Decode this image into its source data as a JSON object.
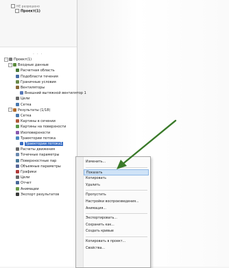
{
  "panel_top": {
    "tab_label": "НЕ разрешено",
    "project_label": "Проект(1)"
  },
  "divider": "· · ·",
  "tree": [
    {
      "label": "Проект(1)",
      "indent": 0,
      "icon": "project-icon",
      "color": "#7a7a7a"
    },
    {
      "label": "Входные данные",
      "indent": 1,
      "icon": "input-data-icon",
      "color": "#5a8a3a"
    },
    {
      "label": "Расчетная область",
      "indent": 2,
      "icon": "domain-icon",
      "color": "#4a7a3a"
    },
    {
      "label": "Подобласти течения",
      "indent": 2,
      "icon": "fluid-subdomain-icon",
      "color": "#4a6fa8"
    },
    {
      "label": "Граничные условия",
      "indent": 2,
      "icon": "boundary-icon",
      "color": "#6a8a4a"
    },
    {
      "label": "Вентиляторы",
      "indent": 2,
      "icon": "fan-icon",
      "color": "#8a6a3a"
    },
    {
      "label": "Внешний вытяжной вентилятор 1",
      "indent": 3,
      "icon": "fan-item-icon",
      "color": "#5a7ab8"
    },
    {
      "label": "Цели",
      "indent": 2,
      "icon": "goals-icon",
      "color": "#6a6a6a"
    },
    {
      "label": "Сетка",
      "indent": 2,
      "icon": "mesh-icon",
      "color": "#4a7ab0"
    },
    {
      "label": "Результаты (1/18)",
      "indent": 1,
      "icon": "results-icon",
      "color": "#b06a2a"
    },
    {
      "label": "Сетка",
      "indent": 2,
      "icon": "mesh-icon",
      "color": "#4a7ab0"
    },
    {
      "label": "Картины в сечении",
      "indent": 2,
      "icon": "cut-plot-icon",
      "color": "#b05a3a"
    },
    {
      "label": "Картины на поверхности",
      "indent": 2,
      "icon": "surface-plot-icon",
      "color": "#5a9a4a"
    },
    {
      "label": "Изоповерхности",
      "indent": 2,
      "icon": "isosurface-icon",
      "color": "#8a5ab0"
    },
    {
      "label": "Траектории потока",
      "indent": 2,
      "icon": "flow-trajectories-icon",
      "color": "#4a8ac0"
    },
    {
      "label": "Траектории потока1",
      "indent": 3,
      "icon": "trajectory-item-icon",
      "color": "#3a6fc4",
      "selected": true
    },
    {
      "label": "Расчеты движения",
      "indent": 2,
      "icon": "particle-study-icon",
      "color": "#6a6a6a"
    },
    {
      "label": "Точечные параметры",
      "indent": 2,
      "icon": "point-params-icon",
      "color": "#6a8ab0"
    },
    {
      "label": "Поверхностные пар",
      "indent": 2,
      "icon": "surface-params-icon",
      "color": "#4a7a9a"
    },
    {
      "label": "Объемные параметры",
      "indent": 2,
      "icon": "volume-params-icon",
      "color": "#5a6a9a"
    },
    {
      "label": "Графики",
      "indent": 2,
      "icon": "xy-plot-icon",
      "color": "#b03a3a"
    },
    {
      "label": "Цели",
      "indent": 2,
      "icon": "goals-icon",
      "color": "#6a6a6a"
    },
    {
      "label": "Отчет",
      "indent": 2,
      "icon": "report-icon",
      "color": "#4a6a9a"
    },
    {
      "label": "Анимации",
      "indent": 2,
      "icon": "animation-icon",
      "color": "#6a9a4a"
    },
    {
      "label": "Экспорт результатов",
      "indent": 2,
      "icon": "export-icon",
      "color": "#3a3a3a"
    }
  ],
  "context_menu": {
    "items": [
      {
        "label": "Изменить...",
        "type": "item"
      },
      {
        "type": "sep"
      },
      {
        "label": "Показать",
        "type": "item",
        "highlight": true
      },
      {
        "label": "Копировать",
        "type": "item"
      },
      {
        "label": "Удалить",
        "type": "item"
      },
      {
        "type": "sep"
      },
      {
        "label": "Пропустить",
        "type": "item"
      },
      {
        "label": "Настройки воспроизведения...",
        "type": "item"
      },
      {
        "label": "Анимация...",
        "type": "item"
      },
      {
        "type": "sep"
      },
      {
        "label": "Экспортировать...",
        "type": "item"
      },
      {
        "label": "Сохранить как...",
        "type": "item"
      },
      {
        "label": "Создать кривые",
        "type": "item"
      },
      {
        "type": "sep"
      },
      {
        "label": "Копировать в проект...",
        "type": "item"
      },
      {
        "label": "Свойства...",
        "type": "item"
      }
    ]
  },
  "annotation_arrow": {
    "color": "#3a7a2a"
  }
}
